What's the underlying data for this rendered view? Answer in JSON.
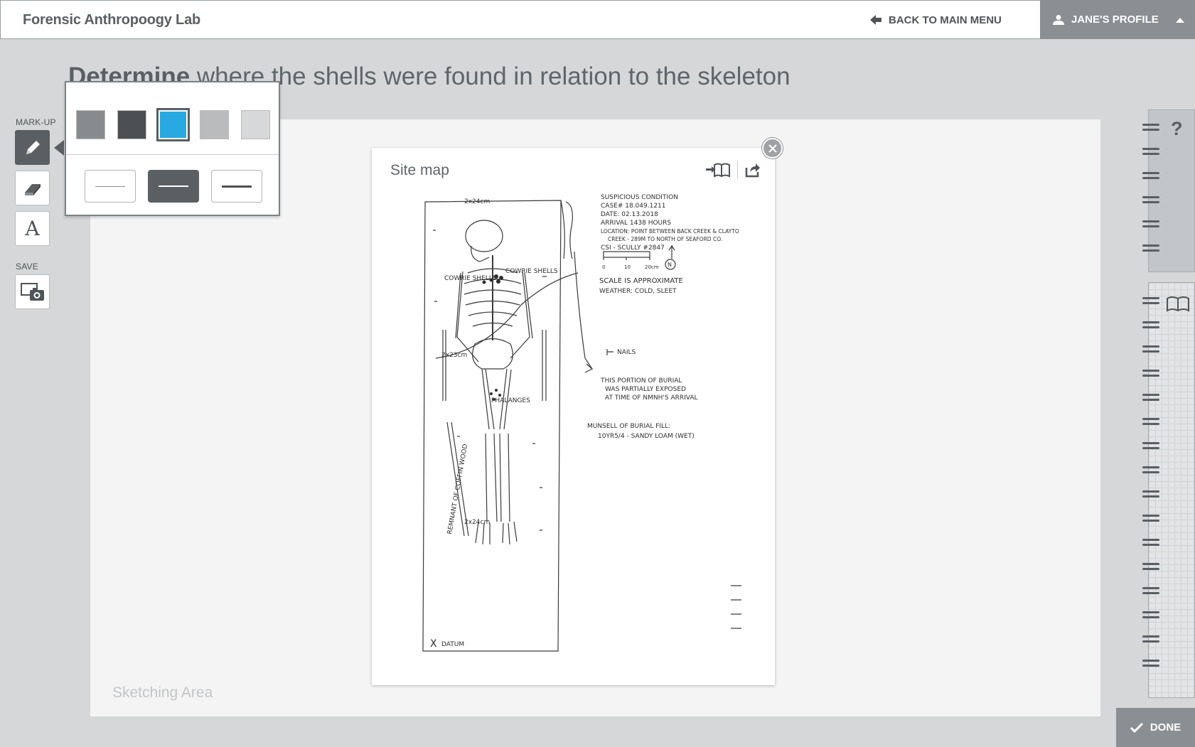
{
  "app": {
    "title": "Forensic Anthropoogy Lab"
  },
  "header": {
    "back_label": "BACK TO MAIN MENU",
    "profile_label": "JANE'S PROFILE"
  },
  "instruction": {
    "bold": "Determine",
    "rest": " where the shells were found in relation to the skeleton"
  },
  "toolbar": {
    "markup_label": "MARK-UP",
    "save_label": "SAVE",
    "tools": [
      "pencil",
      "eraser",
      "text"
    ],
    "active_tool": "pencil"
  },
  "palette": {
    "colors": [
      "#888b8e",
      "#4c4f52",
      "#29a9e1",
      "#b9bbbd",
      "#d6d8d9"
    ],
    "selected_color": "#29a9e1",
    "strokes": [
      "thin",
      "medium",
      "thick"
    ],
    "selected_stroke": "medium"
  },
  "sitemap": {
    "title": "Site map",
    "notes": {
      "line1": "SUSPICIOUS CONDITION",
      "line2": "CASE# 18.049.1211",
      "line3": "DATE: 02.13.2018",
      "line4": "ARRIVAL 1438 HOURS",
      "line5": "LOCATION: POINT BETWEEN BACK CREEK & CLAYTO",
      "line6": "CREEK - 289M TO NORTH OF SEAFORD CO.",
      "line7": "CSI - SCULLY #2847",
      "scale_0": "0",
      "scale_10": "10",
      "scale_20": "20cm",
      "north": "N",
      "scale_note": "SCALE IS APPROXIMATE",
      "weather": "WEATHER: COLD, SLEET",
      "nails": "NAILS",
      "burial1": "THIS PORTION OF BURIAL",
      "burial2": "WAS PARTIALLY EXPOSED",
      "burial3": "AT TIME OF NMNH'S ARRIVAL",
      "munsell1": "MUNSELL OF BURIAL FILL:",
      "munsell2": "10YR5/4 - SANDY LOAM (WET)",
      "cowrie_left": "COWRIE SHELLS",
      "cowrie_right": "COWRIE SHELLS",
      "phalanges": "PHALANGES",
      "remnant": "REMNANT OF COFFIN WOOD",
      "datum": "DATUM",
      "x_marker": "X",
      "m1": "2x24cm",
      "m2": "2x23cm",
      "m3": "2x24cm"
    }
  },
  "sketch": {
    "label": "Sketching Area"
  },
  "done": {
    "label": "DONE"
  }
}
